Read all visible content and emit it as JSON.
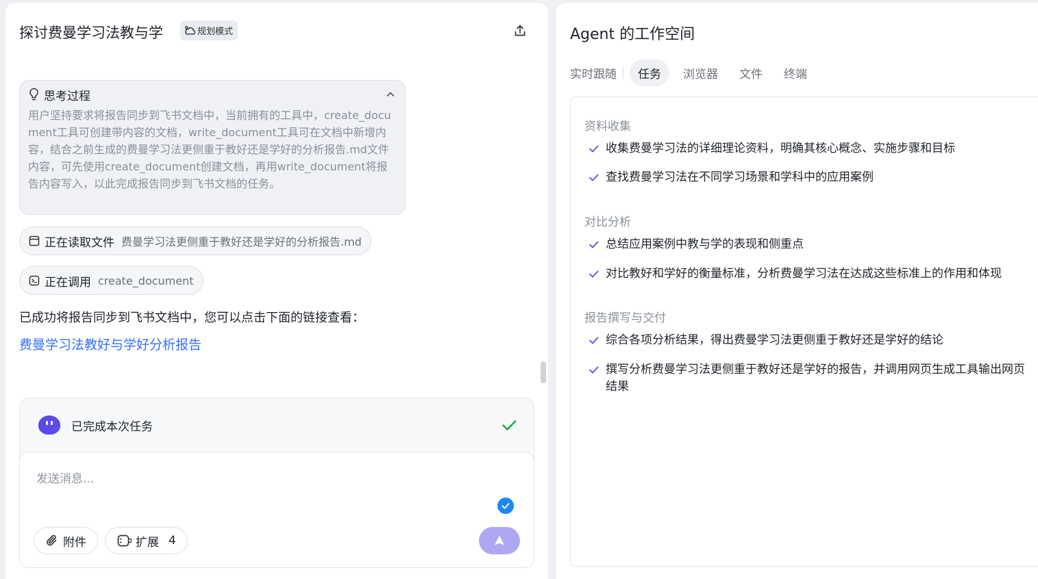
{
  "chat": {
    "title": "探讨费曼学习法教与学",
    "mode_badge": "规划模式",
    "thinking": {
      "label": "思考过程",
      "content": "用户坚持要求将报告同步到飞书文档中，当前拥有的工具中，create_document工具可创建带内容的文档，write_document工具可在文档中新增内容，结合之前生成的费曼学习法更侧重于教好还是学好的分析报告.md文件内容，可先使用create_document创建文档，再用write_document将报告内容写入，以此完成报告同步到飞书文档的任务。"
    },
    "tool_calls": [
      {
        "action": "正在读取文件",
        "arg": "费曼学习法更侧重于教好还是学好的分析报告.md",
        "icon": "file-icon"
      },
      {
        "action": "正在调用",
        "arg": "create_document",
        "icon": "tool-icon"
      }
    ],
    "reply_text": "已成功将报告同步到飞书文档中，您可以点击下面的链接查看：",
    "reply_link": "费曼学习法教好与学好分析报告"
  },
  "composer": {
    "status_text": "已完成本次任务",
    "placeholder": "发送消息...",
    "attach_label": "附件",
    "extend_label": "扩展",
    "extend_count": "4"
  },
  "workspace": {
    "title": "Agent 的工作空间",
    "tabs": [
      "实时跟随",
      "任务",
      "浏览器",
      "文件",
      "终端"
    ],
    "active_tab": "任务",
    "groups": [
      {
        "title": "资料收集",
        "items": [
          "收集费曼学习法的详细理论资料，明确其核心概念、实施步骤和目标",
          "查找费曼学习法在不同学习场景和学科中的应用案例"
        ]
      },
      {
        "title": "对比分析",
        "items": [
          "总结应用案例中教与学的表现和侧重点",
          "对比教好和学好的衡量标准，分析费曼学习法在达成这些标准上的作用和体现"
        ]
      },
      {
        "title": "报告撰写与交付",
        "items": [
          "综合各项分析结果，得出费曼学习法更侧重于教好还是学好的结论",
          "撰写分析费曼学习法更侧重于教好还是学好的报告，并调用网页生成工具输出网页结果"
        ]
      }
    ]
  },
  "colors": {
    "accent": "#5b4ae8",
    "link": "#3370ff",
    "check": "#5b4ae8",
    "success": "#22a84a",
    "send_button": "#aea8f4",
    "status_blue": "#1e88f5"
  }
}
